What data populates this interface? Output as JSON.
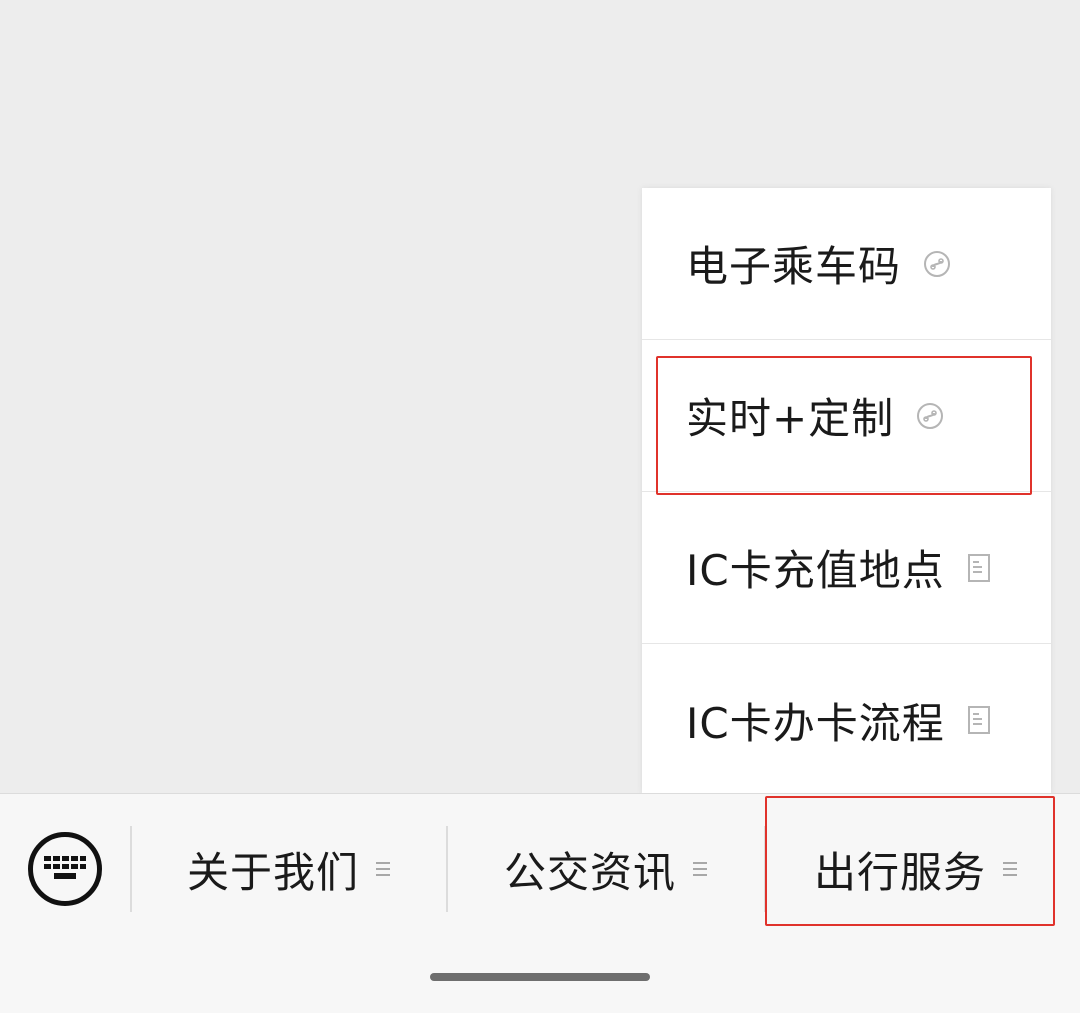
{
  "popup": {
    "items": [
      {
        "label": "电子乘车码",
        "icon": "mini-program-icon"
      },
      {
        "label": "实时+定制",
        "icon": "mini-program-icon"
      },
      {
        "label": "IC卡充值地点",
        "icon": "article-icon"
      },
      {
        "label": "IC卡办卡流程",
        "icon": "article-icon"
      }
    ]
  },
  "menubar": {
    "keyboard_icon": "keyboard-icon",
    "tabs": [
      {
        "label": "关于我们",
        "icon": "submenu-icon"
      },
      {
        "label": "公交资讯",
        "icon": "submenu-icon"
      },
      {
        "label": "出行服务",
        "icon": "submenu-icon"
      }
    ]
  },
  "colors": {
    "highlight": "#e0322b",
    "background": "#ededed",
    "menubar": "#f7f7f7"
  }
}
